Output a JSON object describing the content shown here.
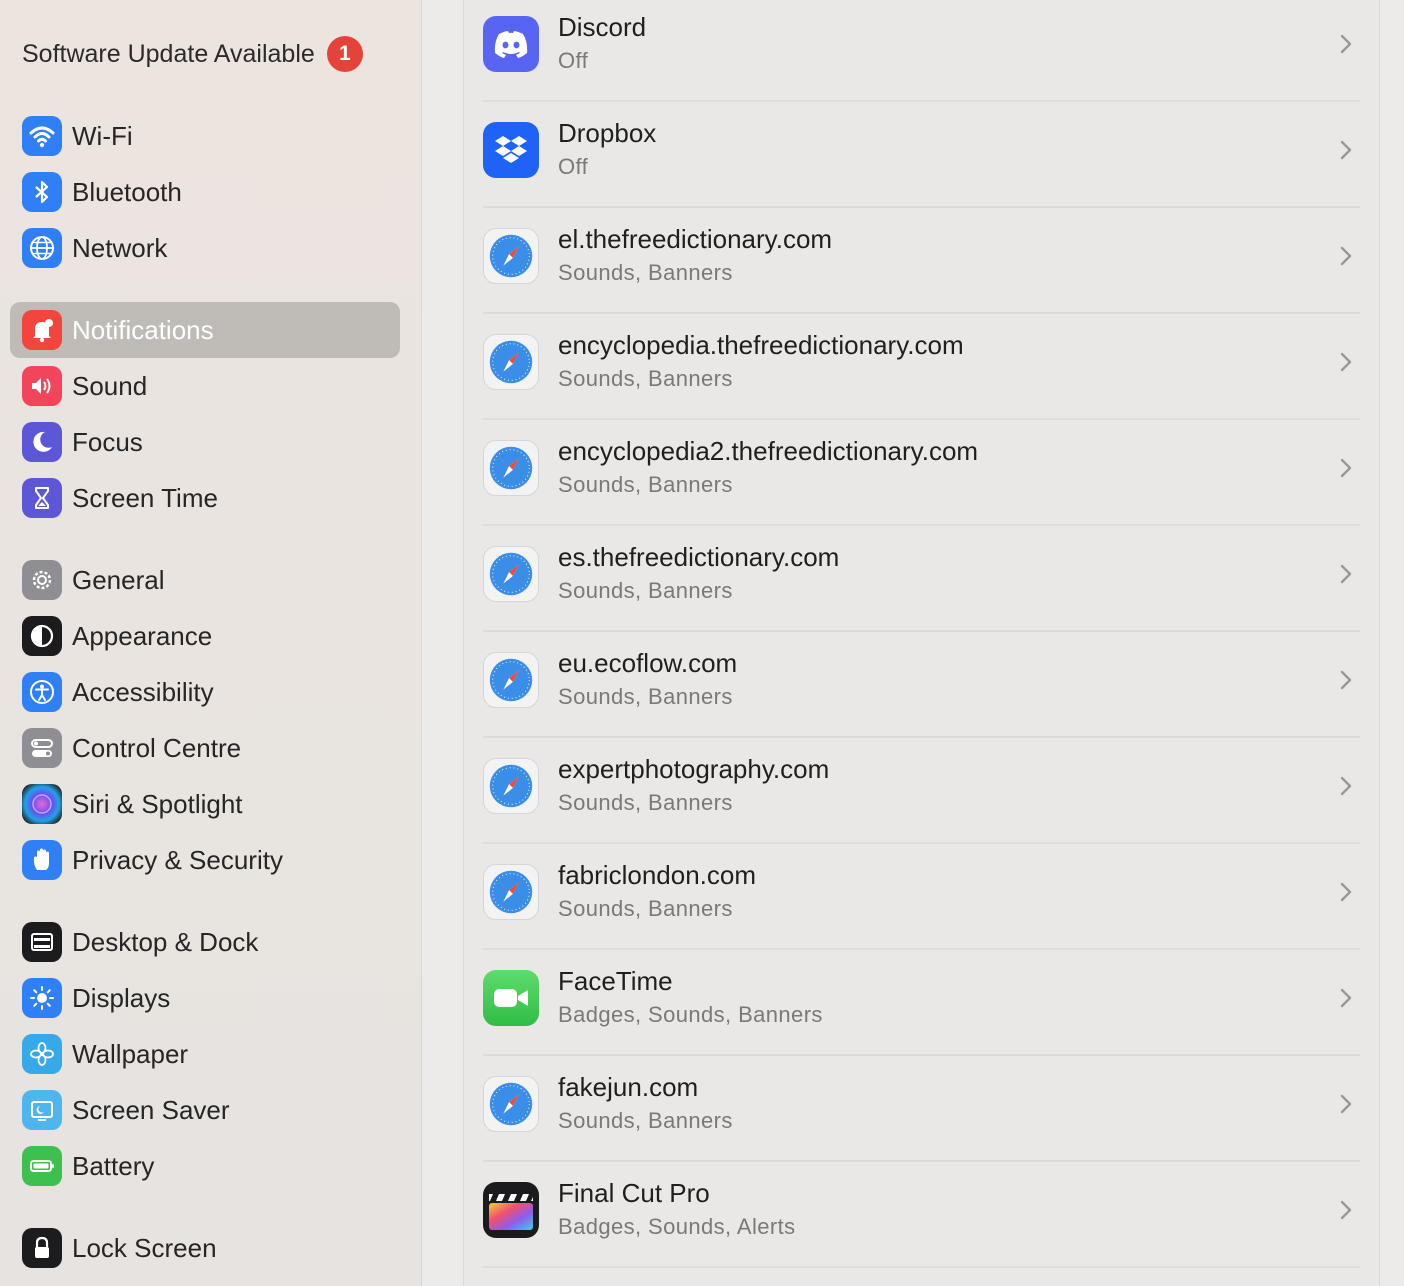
{
  "sidebar": {
    "update": {
      "label": "Software Update Available",
      "badge": "1"
    },
    "items": [
      {
        "label": "Wi-Fi",
        "icon": "wifi-icon",
        "color": "#2f7ff6"
      },
      {
        "label": "Bluetooth",
        "icon": "bluetooth-icon",
        "color": "#2f7ff6"
      },
      {
        "label": "Network",
        "icon": "globe-icon",
        "color": "#2f7ff6"
      },
      {
        "label": "Notifications",
        "icon": "bell-icon",
        "color": "#f2453d",
        "active": true
      },
      {
        "label": "Sound",
        "icon": "speaker-icon",
        "color": "#f2445a"
      },
      {
        "label": "Focus",
        "icon": "moon-icon",
        "color": "#5b57d6"
      },
      {
        "label": "Screen Time",
        "icon": "hourglass-icon",
        "color": "#5b57d6"
      },
      {
        "label": "General",
        "icon": "gear-icon",
        "color": "#8e8e93"
      },
      {
        "label": "Appearance",
        "icon": "appearance-icon",
        "color": "#1c1c1e"
      },
      {
        "label": "Accessibility",
        "icon": "accessibility-icon",
        "color": "#2f7ff6"
      },
      {
        "label": "Control Centre",
        "icon": "control-centre-icon",
        "color": "#8e8e93"
      },
      {
        "label": "Siri & Spotlight",
        "icon": "siri-icon",
        "color": "#222222"
      },
      {
        "label": "Privacy & Security",
        "icon": "hand-icon",
        "color": "#2f7ff6"
      },
      {
        "label": "Desktop & Dock",
        "icon": "dock-icon",
        "color": "#1c1c1e"
      },
      {
        "label": "Displays",
        "icon": "sun-icon",
        "color": "#2f7ff6"
      },
      {
        "label": "Wallpaper",
        "icon": "flower-icon",
        "color": "#36a9e8"
      },
      {
        "label": "Screen Saver",
        "icon": "screen-saver-icon",
        "color": "#4fb5ef"
      },
      {
        "label": "Battery",
        "icon": "battery-icon",
        "color": "#3ec04f"
      },
      {
        "label": "Lock Screen",
        "icon": "lock-icon",
        "color": "#1c1c1e"
      }
    ]
  },
  "apps": [
    {
      "name": "Discord",
      "detail": "Off",
      "icon": "discord-icon"
    },
    {
      "name": "Dropbox",
      "detail": "Off",
      "icon": "dropbox-icon"
    },
    {
      "name": "el.thefreedictionary.com",
      "detail": "Sounds, Banners",
      "icon": "safari-icon"
    },
    {
      "name": "encyclopedia.thefreedictionary.com",
      "detail": "Sounds, Banners",
      "icon": "safari-icon"
    },
    {
      "name": "encyclopedia2.thefreedictionary.com",
      "detail": "Sounds, Banners",
      "icon": "safari-icon"
    },
    {
      "name": "es.thefreedictionary.com",
      "detail": "Sounds, Banners",
      "icon": "safari-icon"
    },
    {
      "name": "eu.ecoflow.com",
      "detail": "Sounds, Banners",
      "icon": "safari-icon"
    },
    {
      "name": "expertphotography.com",
      "detail": "Sounds, Banners",
      "icon": "safari-icon"
    },
    {
      "name": "fabriclondon.com",
      "detail": "Sounds, Banners",
      "icon": "safari-icon"
    },
    {
      "name": "FaceTime",
      "detail": "Badges, Sounds, Banners",
      "icon": "facetime-icon"
    },
    {
      "name": "fakejun.com",
      "detail": "Sounds, Banners",
      "icon": "safari-icon"
    },
    {
      "name": "Final Cut Pro",
      "detail": "Badges, Sounds, Alerts",
      "icon": "final-cut-pro-icon"
    }
  ]
}
